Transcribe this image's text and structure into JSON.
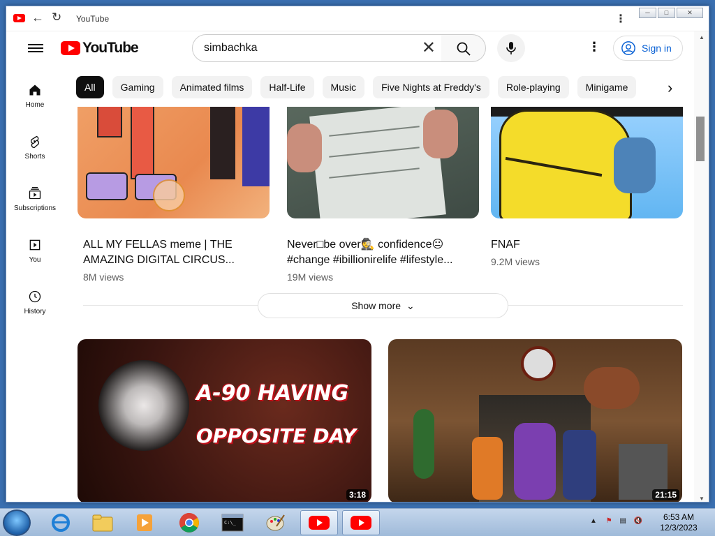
{
  "browser": {
    "title": "YouTube"
  },
  "header": {
    "logo_text": "YouTube",
    "search_value": "simbachka",
    "signin_label": "Sign in"
  },
  "sidebar": {
    "items": [
      {
        "label": "Home",
        "icon": "home-icon"
      },
      {
        "label": "Shorts",
        "icon": "shorts-icon"
      },
      {
        "label": "Subscriptions",
        "icon": "subscriptions-icon"
      },
      {
        "label": "You",
        "icon": "you-icon"
      },
      {
        "label": "History",
        "icon": "history-icon"
      }
    ]
  },
  "chips": [
    "All",
    "Gaming",
    "Animated films",
    "Half-Life",
    "Music",
    "Five Nights at Freddy's",
    "Role-playing",
    "Minigame"
  ],
  "shorts": [
    {
      "title_line1": "ALL MY FELLAS meme | THE",
      "title_line2": "AMAZING DIGITAL CIRCUS...",
      "views": "8M views"
    },
    {
      "title_line1": "Never□be over🕵 confidence😐",
      "title_line2": "#change #ibillionirelife #lifestyle...",
      "views": "19M views"
    },
    {
      "title_line1": "FNAF",
      "title_line2": "",
      "views": "9.2M views"
    }
  ],
  "show_more_label": "Show more",
  "videos": [
    {
      "thumb_text_line1": "A-90 HAVING",
      "thumb_text_line2": "OPPOSITE DAY",
      "duration": "3:18"
    },
    {
      "thumb_text_line1": "",
      "thumb_text_line2": "",
      "duration": "21:15"
    }
  ],
  "taskbar": {
    "time": "6:53 AM",
    "date": "12/3/2023"
  },
  "colors": {
    "youtube_red": "#ff0000",
    "link_blue": "#065fd4",
    "chip_active": "#0f0f0f"
  }
}
